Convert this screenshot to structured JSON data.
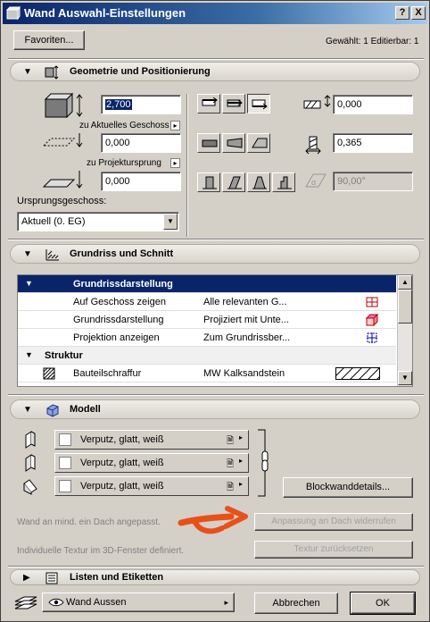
{
  "window": {
    "title": "Wand Auswahl-Einstellungen",
    "help_label": "?",
    "close_label": "X"
  },
  "top": {
    "favorites_label": "Favoriten...",
    "selection_status": "Gewählt: 1 Editierbar: 1"
  },
  "geometry": {
    "title": "Geometrie und Positionierung",
    "height_value": "2,700",
    "ref_story_label": "zu Aktuelles Geschoss",
    "bottom_offset_value": "0,000",
    "project_origin_label": "zu Projektursprung",
    "elevation_value": "0,000",
    "home_story_label": "Ursprungsgeschoss:",
    "home_story_value": "Aktuell (0. EG)",
    "offset_value": "0,000",
    "thickness_value": "0,365",
    "angle_value": "90,00°"
  },
  "floorplan": {
    "title": "Grundriss und Schnitt",
    "groups": [
      {
        "label": "Grundrissdarstellung"
      },
      {
        "label": "Struktur"
      }
    ],
    "rows": [
      {
        "name": "Auf Geschoss zeigen",
        "value": "Alle relevanten G..."
      },
      {
        "name": "Grundrissdarstellung",
        "value": "Projiziert mit Unte..."
      },
      {
        "name": "Projektion anzeigen",
        "value": "Zum Grundrissber..."
      },
      {
        "name": "Bauteilschraffur",
        "value": "MW Kalksandstein"
      }
    ]
  },
  "model": {
    "title": "Modell",
    "surfaces": [
      {
        "label": "Verputz, glatt, weiß"
      },
      {
        "label": "Verputz, glatt, weiß"
      },
      {
        "label": "Verputz, glatt, weiß"
      }
    ],
    "block_details_label": "Blockwanddetails...",
    "roof_note": "Wand an mind. ein Dach angepasst.",
    "undo_roof_label": "Anpassung an Dach widerrufen",
    "texture_note": "Individuelle Textur im 3D-Fenster definiert.",
    "reset_texture_label": "Textur zurücksetzen"
  },
  "lists": {
    "title": "Listen und Etiketten"
  },
  "bottom": {
    "layer_value": "Wand Aussen",
    "cancel_label": "Abbrechen",
    "ok_label": "OK"
  },
  "colors": {
    "titlebar": "#0a246a",
    "selection": "#0a246a",
    "annotation_arrow": "#e8501a"
  }
}
